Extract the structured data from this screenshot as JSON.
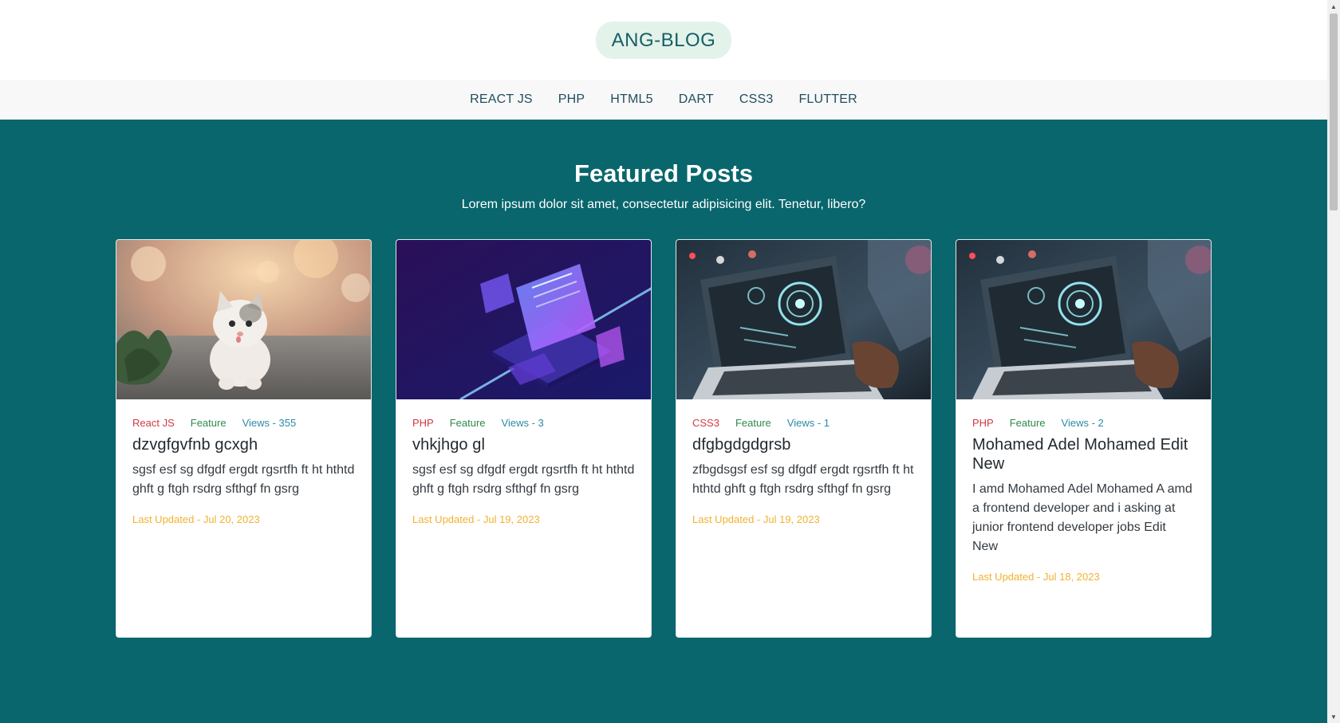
{
  "header": {
    "logo": "ANG-BLOG"
  },
  "nav": {
    "items": [
      {
        "label": "REACT JS"
      },
      {
        "label": "PHP"
      },
      {
        "label": "HTML5"
      },
      {
        "label": "DART"
      },
      {
        "label": "CSS3"
      },
      {
        "label": "FLUTTER"
      }
    ]
  },
  "featured": {
    "title": "Featured Posts",
    "subtitle": "Lorem ipsum dolor sit amet, consectetur adipisicing elit. Tenetur, libero?"
  },
  "cards": [
    {
      "image": "kitten-photo",
      "category": "React JS",
      "tag": "Feature",
      "views": "Views - 355",
      "title": "dzvgfgvfnb gcxgh",
      "excerpt": "sgsf esf sg dfgdf ergdt rgsrtfh ft ht hthtd ghft g ftgh rsdrg sfthgf fn gsrg",
      "updated": "Last Updated - Jul 20, 2023"
    },
    {
      "image": "isometric-laptop-illustration",
      "category": "PHP",
      "tag": "Feature",
      "views": "Views - 3",
      "title": "vhkjhgo gl",
      "excerpt": "sgsf esf sg dfgdf ergdt rgsrtfh ft ht hthtd ghft g ftgh rsdrg sfthgf fn gsrg",
      "updated": "Last Updated - Jul 19, 2023"
    },
    {
      "image": "laptop-hologram-photo",
      "category": "CSS3",
      "tag": "Feature",
      "views": "Views - 1",
      "title": "dfgbgdgdgrsb",
      "excerpt": "zfbgdsgsf esf sg dfgdf ergdt rgsrtfh ft ht hthtd ghft g ftgh rsdrg sfthgf fn gsrg",
      "updated": "Last Updated - Jul 19, 2023"
    },
    {
      "image": "laptop-hologram-photo",
      "category": "PHP",
      "tag": "Feature",
      "views": "Views - 2",
      "title": "Mohamed Adel Mohamed Edit New",
      "excerpt": "I amd Mohamed Adel Mohamed A amd a frontend developer and i asking at junior frontend developer jobs Edit New",
      "updated": "Last Updated - Jul 18, 2023"
    }
  ],
  "colors": {
    "brand_teal": "#08666c",
    "logo_bg": "#e3f3ea",
    "category_red": "#d03a45",
    "tag_green": "#2e8a4a",
    "views_blue": "#2a8aa6",
    "updated_orange": "#f2b230"
  }
}
